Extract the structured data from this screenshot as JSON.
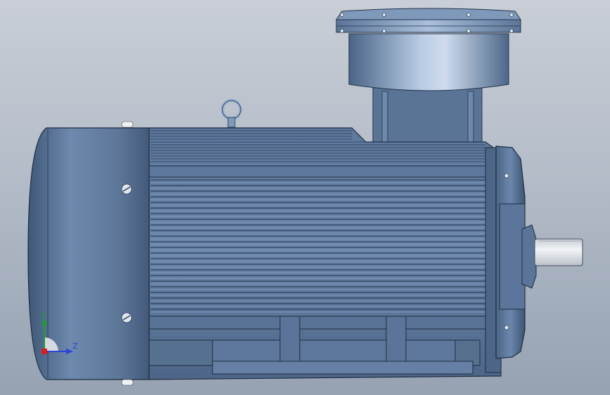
{
  "viewport": {
    "background_top": "#c9ced6",
    "background_bottom": "#96a2b2"
  },
  "model": {
    "description": "motor-3d-model",
    "body_color": "#5f7a9c",
    "shaft_color": "#e4e8ec"
  },
  "triad": {
    "y_label": "Y",
    "z_label": "Z",
    "y_color": "#1f9e2f",
    "z_color": "#2a44d8",
    "x_color": "#d81e1e"
  }
}
